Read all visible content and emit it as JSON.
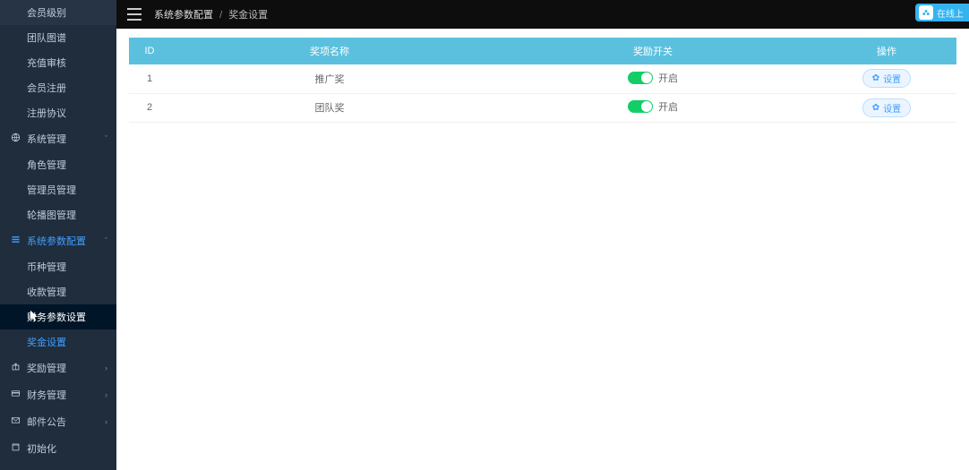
{
  "sidebar": {
    "pre_items": [
      {
        "label": "会员级别"
      },
      {
        "label": "团队图谱"
      },
      {
        "label": "充值审核"
      },
      {
        "label": "会员注册"
      },
      {
        "label": "注册协议"
      }
    ],
    "group_system": {
      "label": "系统管理",
      "icon": "globe"
    },
    "system_items": [
      {
        "label": "角色管理"
      },
      {
        "label": "管理员管理"
      },
      {
        "label": "轮播图管理"
      }
    ],
    "group_params": {
      "label": "系统参数配置",
      "icon": "bars"
    },
    "params_items": [
      {
        "label": "币种管理"
      },
      {
        "label": "收款管理"
      },
      {
        "label": "财务参数设置"
      },
      {
        "label": "奖金设置"
      }
    ],
    "group_record": {
      "label": "奖励管理",
      "icon": "gift"
    },
    "group_finance": {
      "label": "财务管理",
      "icon": "card"
    },
    "group_mail": {
      "label": "邮件公告",
      "icon": "mail"
    },
    "group_init": {
      "label": "初始化",
      "icon": "refresh"
    }
  },
  "topbar": {
    "crumb1": "系统参数配置",
    "crumb2": "奖金设置",
    "online": "在线上"
  },
  "table": {
    "headers": {
      "id": "ID",
      "name": "奖项名称",
      "switch": "奖励开关",
      "op": "操作"
    },
    "switch_on_label": "开启",
    "set_button": "设置",
    "rows": [
      {
        "id": "1",
        "name": "推广奖",
        "on": true
      },
      {
        "id": "2",
        "name": "团队奖",
        "on": true
      }
    ]
  }
}
